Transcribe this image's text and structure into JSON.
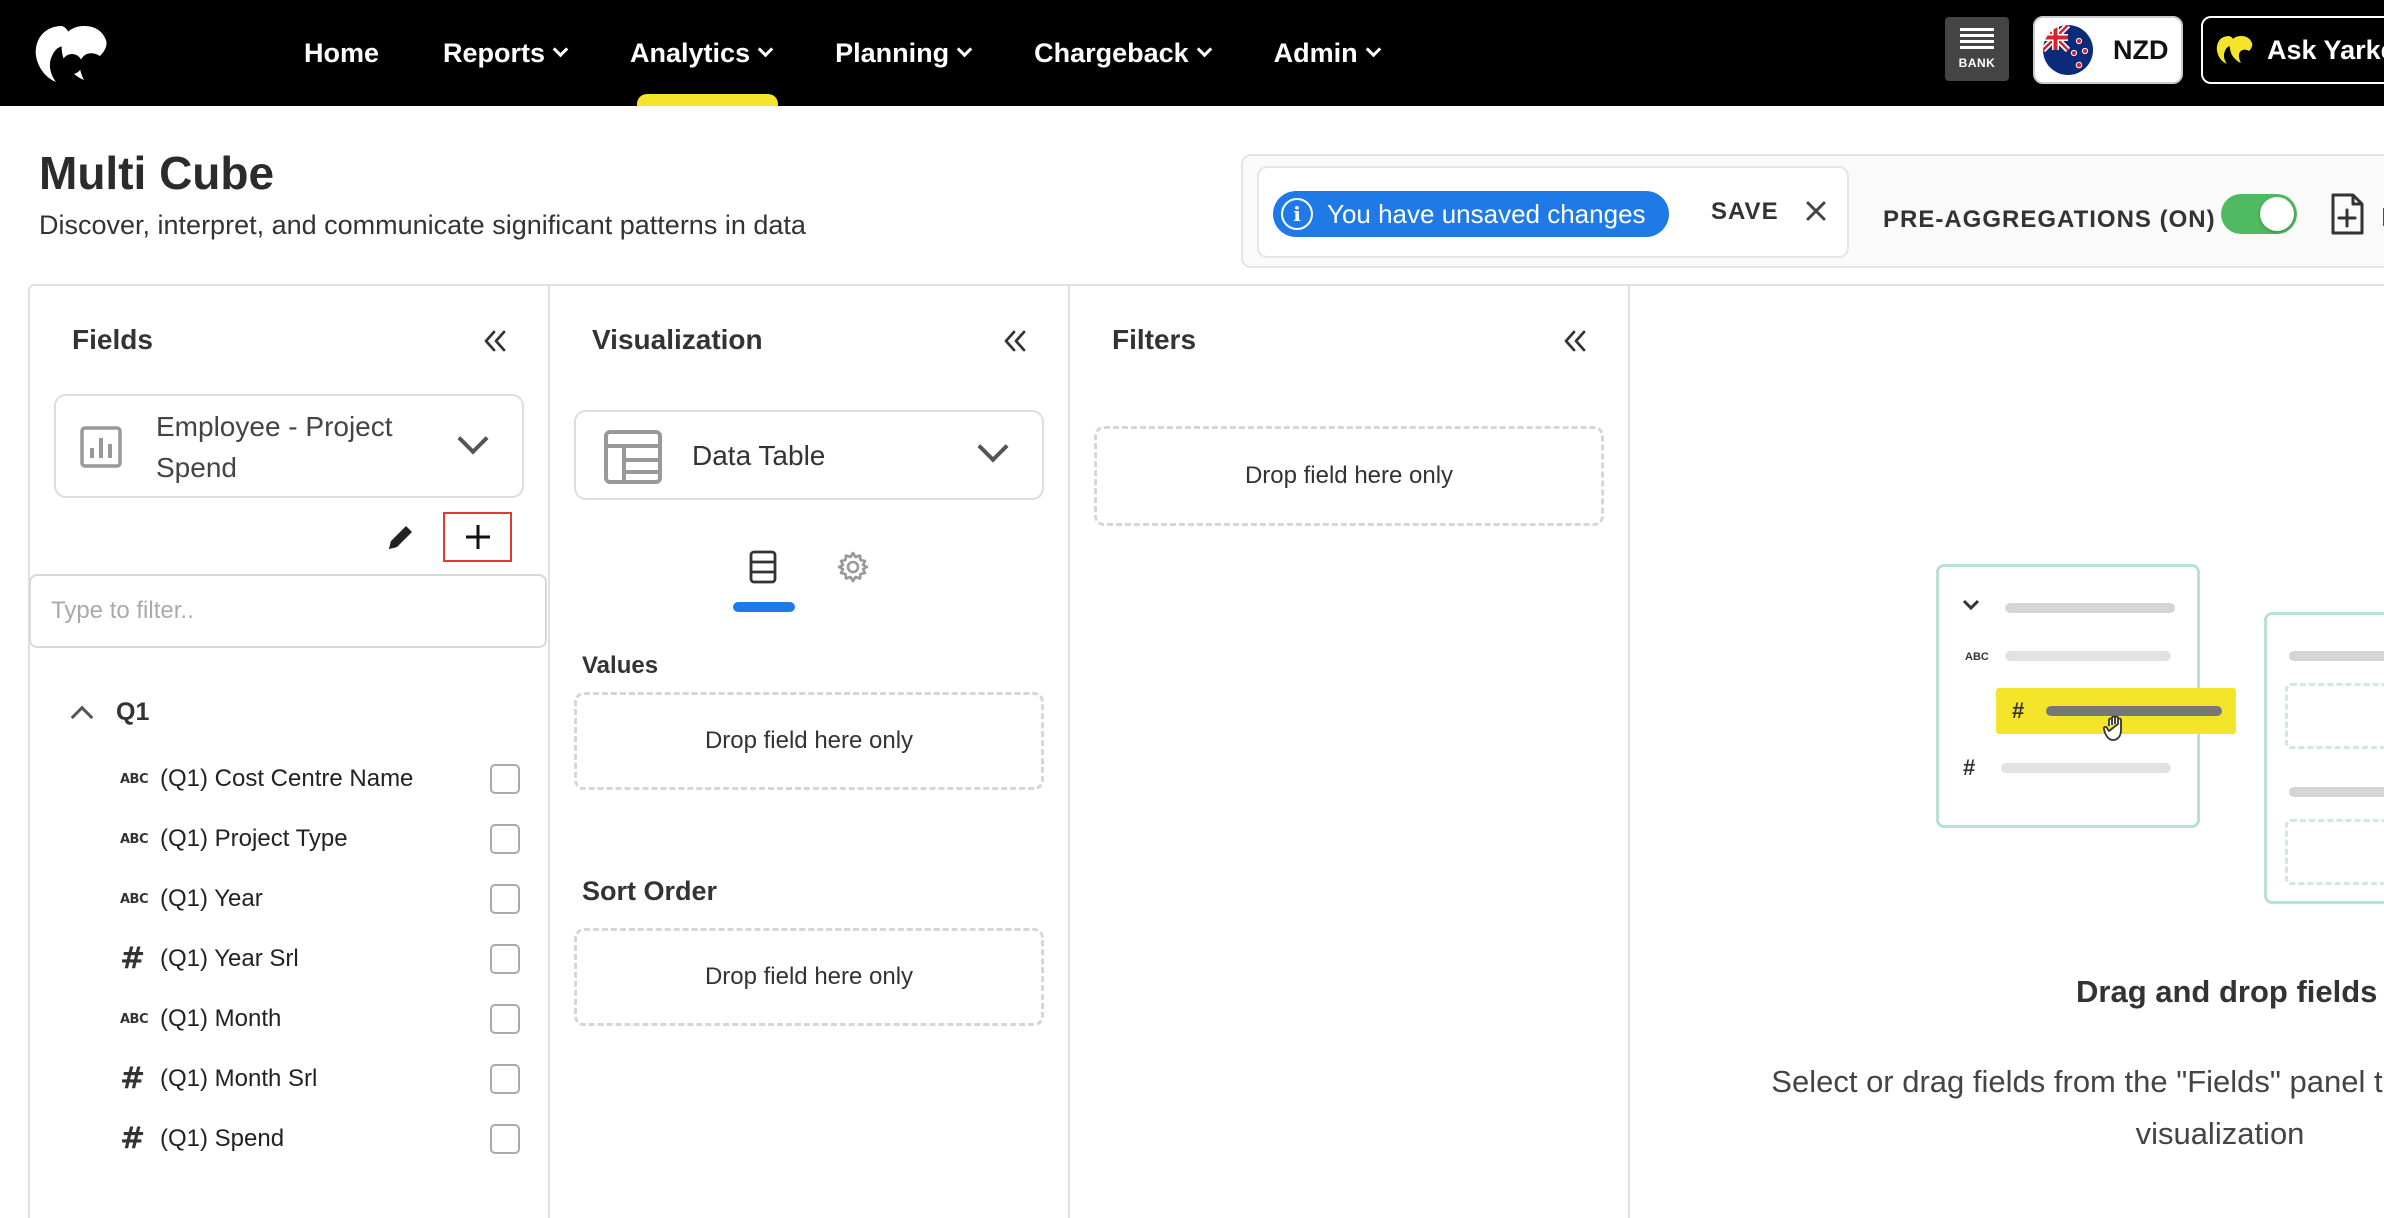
{
  "topnav": {
    "items": [
      {
        "label": "Home",
        "has_menu": false,
        "active": false
      },
      {
        "label": "Reports",
        "has_menu": true,
        "active": false
      },
      {
        "label": "Analytics",
        "has_menu": true,
        "active": true
      },
      {
        "label": "Planning",
        "has_menu": true,
        "active": false
      },
      {
        "label": "Chargeback",
        "has_menu": true,
        "active": false
      },
      {
        "label": "Admin",
        "has_menu": true,
        "active": false
      }
    ],
    "bank_label": "BANK",
    "currency": "NZD",
    "ask_label": "Ask Yarke"
  },
  "header": {
    "title": "Multi Cube",
    "subtitle": "Discover, interpret, and communicate significant patterns in data"
  },
  "actions": {
    "unsaved_text": "You have unsaved changes",
    "info_glyph": "i",
    "save_label": "SAVE",
    "preagg_label": "PRE-AGGREGATIONS (ON)",
    "preagg_on": true,
    "new_label": "N"
  },
  "fields_panel": {
    "title": "Fields",
    "dataset": "Employee - Project Spend",
    "filter_placeholder": "Type to filter..",
    "group_label": "Q1",
    "abc_glyph": "ABC",
    "hash_glyph": "#",
    "fields": [
      {
        "type": "text",
        "label": "(Q1) Cost Centre Name"
      },
      {
        "type": "text",
        "label": "(Q1) Project Type"
      },
      {
        "type": "text",
        "label": "(Q1) Year"
      },
      {
        "type": "number",
        "label": "(Q1) Year Srl"
      },
      {
        "type": "text",
        "label": "(Q1) Month"
      },
      {
        "type": "number",
        "label": "(Q1) Month Srl"
      },
      {
        "type": "number",
        "label": "(Q1) Spend"
      }
    ]
  },
  "viz_panel": {
    "title": "Visualization",
    "type": "Data Table",
    "values_label": "Values",
    "values_drop": "Drop field here only",
    "sort_label": "Sort Order",
    "sort_drop": "Drop field here only"
  },
  "filters_panel": {
    "title": "Filters",
    "drop": "Drop field here only"
  },
  "empty_state": {
    "illustration_abc": "ABC",
    "illustration_hash": "#",
    "title": "Drag and drop fields",
    "description": "Select or drag fields from the \"Fields\" panel to see the changes in visualization"
  },
  "colors": {
    "accent": "#1f7ae8",
    "brand_yellow": "#f5e52a",
    "toggle_on": "#4fba5f",
    "highlight_red": "#e03b2e"
  }
}
